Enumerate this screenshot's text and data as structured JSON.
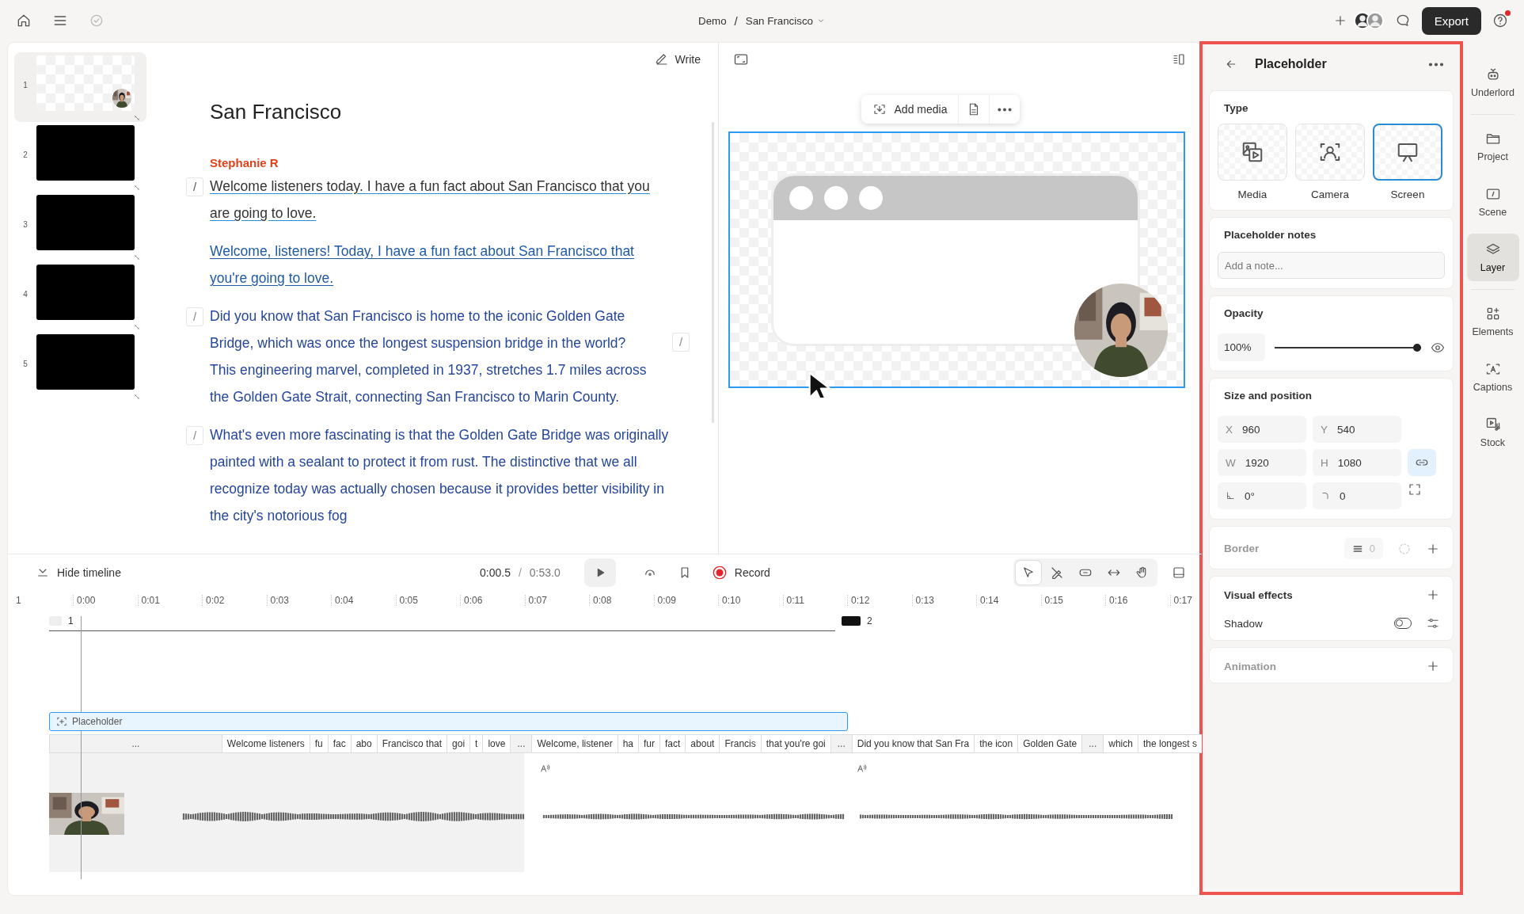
{
  "topbar": {
    "breadcrumb": [
      "Demo",
      "San Francisco"
    ],
    "separator": "/",
    "export": "Export",
    "notification": true
  },
  "slides": [
    {
      "number": "1",
      "kind": "placeholder",
      "selected": true
    },
    {
      "number": "2",
      "kind": "blank",
      "selected": false
    },
    {
      "number": "3",
      "kind": "blank",
      "selected": false
    },
    {
      "number": "4",
      "kind": "blank",
      "selected": false
    },
    {
      "number": "5",
      "kind": "blank",
      "selected": false
    }
  ],
  "script": {
    "write": "Write",
    "title": "San Francisco",
    "speaker": "Stephanie R",
    "paragraphs": [
      {
        "kind": "edited",
        "segments": [
          {
            "kind": "marker",
            "text": "/"
          },
          {
            "kind": "text",
            "text": "Welcome listeners today. I have a fun fact about San Francisco that you are going to love."
          }
        ]
      },
      {
        "kind": "suggested",
        "segments": [
          {
            "kind": "text",
            "text": "Welcome, listeners! Today, I have a fun fact about San Francisco that you're going to love."
          }
        ]
      },
      {
        "kind": "plain",
        "segments": [
          {
            "kind": "marker",
            "text": "/"
          },
          {
            "kind": "text",
            "text": "Did you know that San Francisco is home to the iconic Golden Gate Bridge, which was once the longest suspension bridge in the world?"
          },
          {
            "kind": "marker",
            "text": "/"
          },
          {
            "kind": "text",
            "text": "This engineering marvel, completed in 1937, stretches 1.7 miles across the Golden Gate Strait, connecting San Francisco to Marin County."
          }
        ]
      },
      {
        "kind": "plain",
        "segments": [
          {
            "kind": "marker",
            "text": "/"
          },
          {
            "kind": "text",
            "text": "What's even more fascinating is that the Golden Gate Bridge was originally painted with a sealant to protect it from rust. The distinctive that we all recognize today was actually chosen because it provides better visibility in the city's notorious fog"
          }
        ]
      }
    ]
  },
  "preview": {
    "add_media": "Add media"
  },
  "timeline": {
    "hide": "Hide timeline",
    "current": "0:00.5",
    "separator": "/",
    "duration": "0:53.0",
    "record": "Record",
    "tools": [
      {
        "kind": "select",
        "selected": true
      },
      {
        "kind": "draw",
        "selected": false
      },
      {
        "kind": "clip",
        "selected": false
      },
      {
        "kind": "stretch",
        "selected": false
      },
      {
        "kind": "hand",
        "selected": false
      }
    ],
    "ruler": [
      "1",
      "0:00",
      "0:01",
      "0:02",
      "0:03",
      "0:04",
      "0:05",
      "0:06",
      "0:07",
      "0:08",
      "0:09",
      "0:10",
      "0:11",
      "0:12",
      "0:13",
      "0:14",
      "0:15",
      "0:16",
      "0:17"
    ],
    "scenes": [
      {
        "label": "1",
        "kind": "placeholder"
      },
      {
        "label": "2",
        "kind": "blank"
      }
    ],
    "clip": {
      "label": "Placeholder"
    },
    "transcript": [
      {
        "kind": "gap",
        "text": "..."
      },
      {
        "kind": "word",
        "text": "Welcome listeners"
      },
      {
        "kind": "word",
        "text": "fu"
      },
      {
        "kind": "word",
        "text": "fac"
      },
      {
        "kind": "word",
        "text": "abo"
      },
      {
        "kind": "word",
        "text": "Francisco that"
      },
      {
        "kind": "word",
        "text": "goi"
      },
      {
        "kind": "word",
        "text": "t"
      },
      {
        "kind": "word",
        "text": "love"
      },
      {
        "kind": "gap",
        "text": "..."
      },
      {
        "kind": "word",
        "text": "Welcome, listener"
      },
      {
        "kind": "word",
        "text": "ha"
      },
      {
        "kind": "word",
        "text": "fur"
      },
      {
        "kind": "word",
        "text": "fact"
      },
      {
        "kind": "word",
        "text": "about"
      },
      {
        "kind": "word",
        "text": "Francis"
      },
      {
        "kind": "word",
        "text": "that you're goi"
      },
      {
        "kind": "gap",
        "text": "..."
      },
      {
        "kind": "word",
        "text": "Did you know that San Fra"
      },
      {
        "kind": "word",
        "text": "the icon"
      },
      {
        "kind": "word",
        "text": "Golden Gate"
      },
      {
        "kind": "gap",
        "text": "..."
      },
      {
        "kind": "word",
        "text": "which"
      },
      {
        "kind": "word",
        "text": "the longest s"
      }
    ]
  },
  "panel": {
    "title": "Placeholder",
    "type": {
      "label": "Type",
      "options": [
        {
          "label": "Media",
          "kind": "media",
          "selected": false
        },
        {
          "label": "Camera",
          "kind": "camera",
          "selected": false
        },
        {
          "label": "Screen",
          "kind": "screen",
          "selected": true
        }
      ]
    },
    "notes": {
      "label": "Placeholder notes",
      "placeholder": "Add a note..."
    },
    "opacity": {
      "label": "Opacity",
      "value": "100%",
      "level": 1,
      "visible": true
    },
    "size": {
      "label": "Size and position",
      "linked": true,
      "fields": [
        {
          "kind": "text",
          "prefix": "X",
          "value": "960"
        },
        {
          "kind": "text",
          "prefix": "Y",
          "value": "540"
        },
        {
          "kind": "text",
          "prefix": "W",
          "value": "1920"
        },
        {
          "kind": "text",
          "prefix": "H",
          "value": "1080"
        },
        {
          "kind": "rotation",
          "value": "0°"
        },
        {
          "kind": "radius",
          "value": "0"
        }
      ]
    },
    "border": {
      "label": "Border",
      "value": "0",
      "disabled": true
    },
    "effects": {
      "label": "Visual effects",
      "items": [
        {
          "label": "Shadow",
          "on": false
        }
      ]
    },
    "animation": {
      "label": "Animation",
      "disabled": true
    }
  },
  "rail": [
    {
      "label": "Underlord",
      "kind": "robot",
      "selected": false
    },
    {
      "label": "Project",
      "kind": "folder",
      "selected": false
    },
    {
      "label": "Scene",
      "kind": "scene",
      "selected": false
    },
    {
      "label": "Layer",
      "kind": "layers",
      "selected": true
    },
    {
      "label": "Elements",
      "kind": "elements",
      "selected": false
    },
    {
      "label": "Captions",
      "kind": "captions",
      "selected": false
    },
    {
      "label": "Stock",
      "kind": "stock",
      "selected": false
    }
  ]
}
